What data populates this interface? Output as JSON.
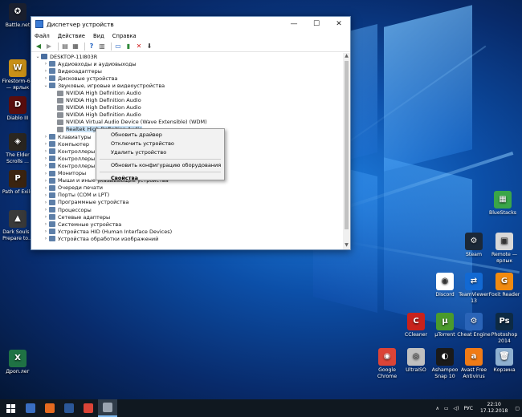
{
  "desktop": {
    "left_icons": [
      {
        "label": "Battle.net",
        "icon": "battlenet-icon",
        "color": "#1a1f2e",
        "glyph": "✪"
      },
      {
        "label": "Firestorm-64 — ярлык",
        "icon": "firestorm-icon",
        "color": "#c89018",
        "glyph": "W"
      },
      {
        "label": "Diablo III",
        "icon": "diablo-icon",
        "color": "#5a0e0e",
        "glyph": "D"
      },
      {
        "label": "The Elder Scrolls ...",
        "icon": "elder-scrolls-icon",
        "color": "#2a2620",
        "glyph": "◈"
      },
      {
        "label": "Path of Exile",
        "icon": "path-of-exile-icon",
        "color": "#3b2410",
        "glyph": "P"
      },
      {
        "label": "Dark Souls - Prepare to...",
        "icon": "dark-souls-icon",
        "color": "#3a3a3a",
        "glyph": "▲"
      },
      {
        "label": "Дроп.лег",
        "icon": "excel-file-icon",
        "color": "#1f7244",
        "glyph": "X"
      }
    ],
    "right_icons": [
      {
        "label": "BlueStacks",
        "icon": "bluestacks-icon",
        "color": "#3aa648",
        "glyph": "▦"
      },
      {
        "label": "Steam",
        "icon": "steam-icon",
        "color": "#1b2838",
        "glyph": "⚙"
      },
      {
        "label": "Remote — ярлык",
        "icon": "remote-shortcut-icon",
        "color": "#d8d8d8",
        "glyph": "▣"
      },
      {
        "label": "Discord",
        "icon": "discord-icon",
        "color": "#ffffff",
        "glyph": "◉"
      },
      {
        "label": "TeamViewer 13",
        "icon": "teamviewer-icon",
        "color": "#1269d3",
        "glyph": "⇄"
      },
      {
        "label": "Foxit Reader",
        "icon": "foxit-reader-icon",
        "color": "#f08a10",
        "glyph": "G"
      },
      {
        "label": "CCleaner",
        "icon": "ccleaner-icon",
        "color": "#c8221c",
        "glyph": "C"
      },
      {
        "label": "µTorrent",
        "icon": "utorrent-icon",
        "color": "#4a9a2c",
        "glyph": "µ"
      },
      {
        "label": "Cheat Engine",
        "icon": "cheat-engine-icon",
        "color": "#2a64b8",
        "glyph": "⚙"
      },
      {
        "label": "Photoshop 2014",
        "icon": "photoshop-icon",
        "color": "#0d2a44",
        "glyph": "Ps"
      },
      {
        "label": "Google Chrome",
        "icon": "chrome-icon",
        "color": "#db4437",
        "glyph": "◉"
      },
      {
        "label": "UltraISO",
        "icon": "ultraiso-icon",
        "color": "#c0c0c0",
        "glyph": "◎"
      },
      {
        "label": "Ashampoo Snap 10",
        "icon": "ashampoo-snap-icon",
        "color": "#1a1a1a",
        "glyph": "◐"
      },
      {
        "label": "Avast Free Antivirus",
        "icon": "avast-icon",
        "color": "#f07b16",
        "glyph": "a"
      },
      {
        "label": "Корзина",
        "icon": "recycle-bin-icon",
        "color": "#8fb0d0",
        "glyph": "🗑"
      }
    ]
  },
  "window": {
    "title": "Диспетчер устройств",
    "minimize": "—",
    "maximize": "☐",
    "close": "✕",
    "menu": [
      "Файл",
      "Действие",
      "Вид",
      "Справка"
    ],
    "root": "DESKTOP-11I803R",
    "tree": [
      {
        "label": "Аудиовходы и аудиовыходы",
        "exp": "›",
        "indent": 1
      },
      {
        "label": "Видеоадаптеры",
        "exp": "›",
        "indent": 1
      },
      {
        "label": "Дисковые устройства",
        "exp": "›",
        "indent": 1
      },
      {
        "label": "Звуковые, игровые и видеоустройства",
        "exp": "⌄",
        "indent": 1
      },
      {
        "label": "NVIDIA High Definition Audio",
        "exp": "",
        "indent": 2
      },
      {
        "label": "NVIDIA High Definition Audio",
        "exp": "",
        "indent": 2
      },
      {
        "label": "NVIDIA High Definition Audio",
        "exp": "",
        "indent": 2
      },
      {
        "label": "NVIDIA High Definition Audio",
        "exp": "",
        "indent": 2
      },
      {
        "label": "NVIDIA Virtual Audio Device (Wave Extensible) (WDM)",
        "exp": "",
        "indent": 2
      },
      {
        "label": "Realtek High Definition Audio",
        "exp": "",
        "indent": 2,
        "selected": true
      },
      {
        "label": "Клавиатуры",
        "exp": "›",
        "indent": 1
      },
      {
        "label": "Компьютер",
        "exp": "›",
        "indent": 1
      },
      {
        "label": "Контроллеры IDE",
        "exp": "›",
        "indent": 1
      },
      {
        "label": "Контроллеры USB",
        "exp": "›",
        "indent": 1
      },
      {
        "label": "Контроллеры запоминающих устройств",
        "exp": "›",
        "indent": 1
      },
      {
        "label": "Мониторы",
        "exp": "›",
        "indent": 1
      },
      {
        "label": "Мыши и иные указывающие устройства",
        "exp": "›",
        "indent": 1
      },
      {
        "label": "Очереди печати",
        "exp": "›",
        "indent": 1
      },
      {
        "label": "Порты (COM и LPT)",
        "exp": "›",
        "indent": 1
      },
      {
        "label": "Программные устройства",
        "exp": "›",
        "indent": 1
      },
      {
        "label": "Процессоры",
        "exp": "›",
        "indent": 1
      },
      {
        "label": "Сетевые адаптеры",
        "exp": "›",
        "indent": 1
      },
      {
        "label": "Системные устройства",
        "exp": "›",
        "indent": 1
      },
      {
        "label": "Устройства HID (Human Interface Devices)",
        "exp": "›",
        "indent": 1
      },
      {
        "label": "Устройства обработки изображений",
        "exp": "›",
        "indent": 1
      }
    ]
  },
  "context_menu": {
    "items": [
      "Обновить драйвер",
      "Отключить устройство",
      "Удалить устройство",
      "Обновить конфигурацию оборудования",
      "Свойства"
    ]
  },
  "taskbar": {
    "apps": [
      {
        "name": "taskbar-save-app",
        "color": "#3a6ec0"
      },
      {
        "name": "taskbar-firefox",
        "color": "#e66a1f"
      },
      {
        "name": "taskbar-word",
        "color": "#2b5797"
      },
      {
        "name": "taskbar-chrome",
        "color": "#db4437"
      },
      {
        "name": "taskbar-device-manager",
        "color": "#9aa4b0"
      }
    ],
    "language": "РУС",
    "time": "22:10",
    "date": "17.12.2018"
  }
}
